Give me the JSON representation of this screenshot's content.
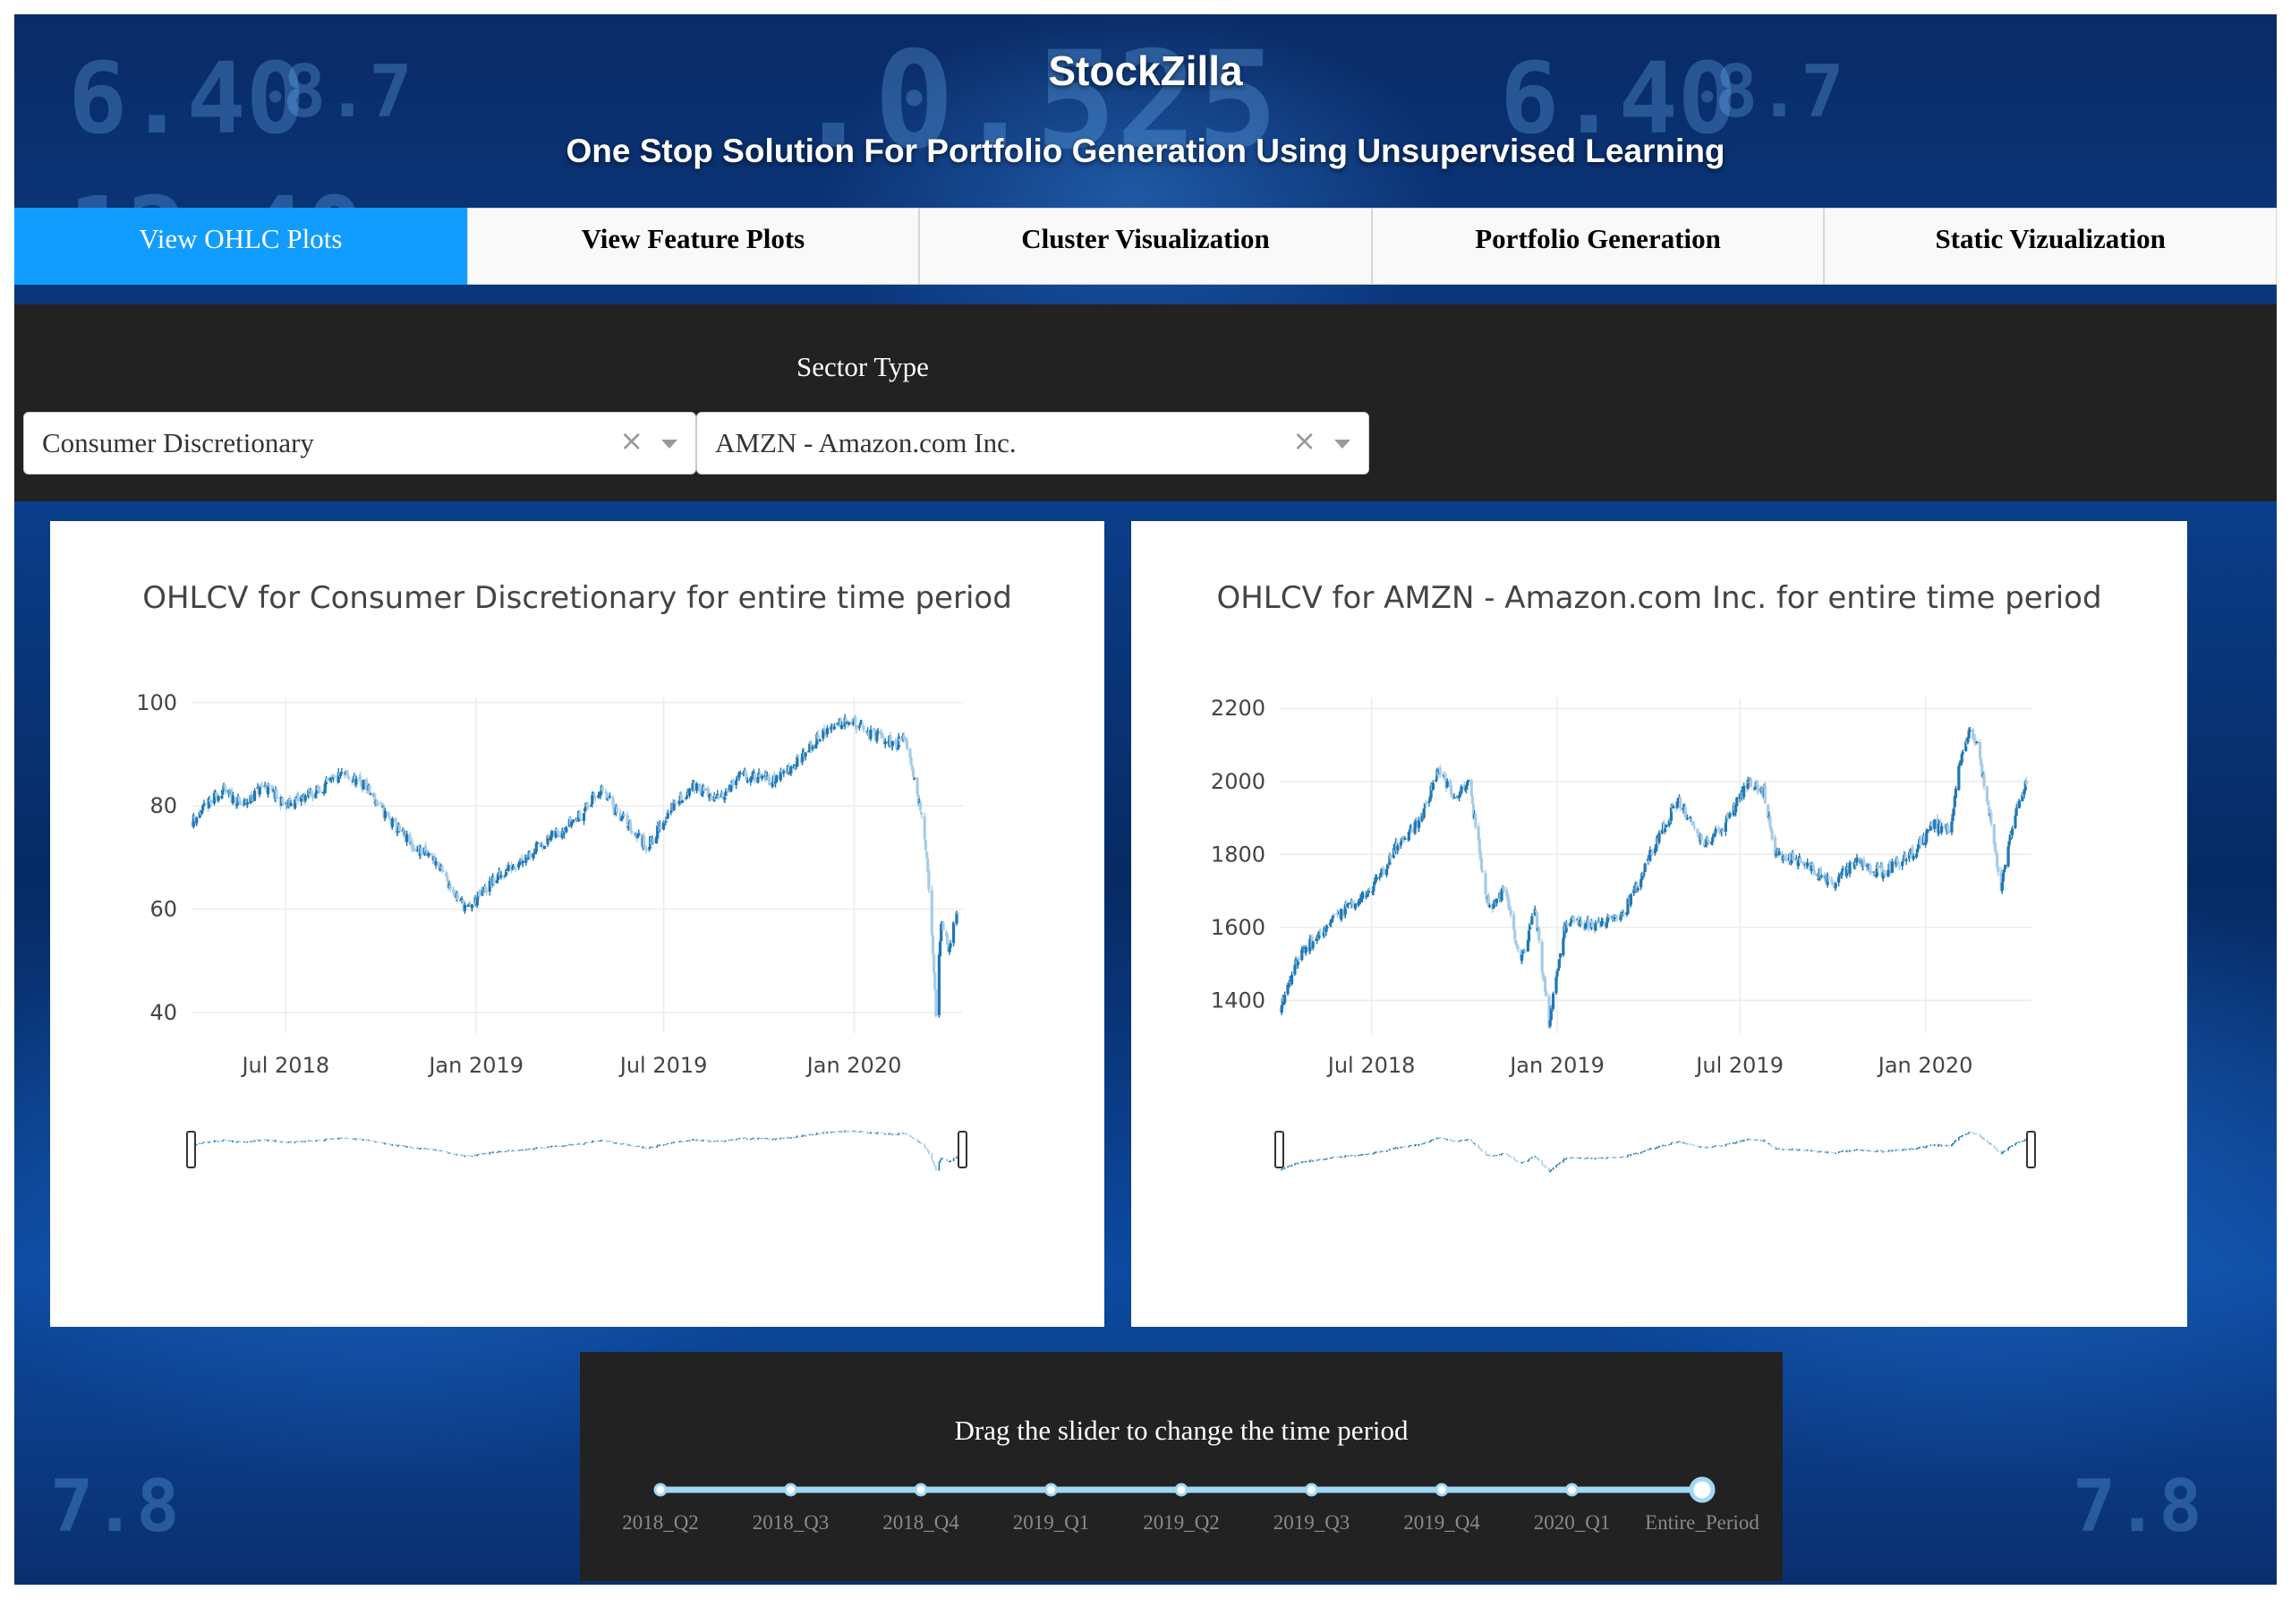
{
  "header": {
    "title": "StockZilla",
    "subtitle": "One Stop Solution For Portfolio Generation Using Unsupervised Learning"
  },
  "tabs": [
    {
      "label": "View OHLC Plots",
      "active": true
    },
    {
      "label": "View Feature Plots",
      "active": false
    },
    {
      "label": "Cluster Visualization",
      "active": false
    },
    {
      "label": "Portfolio Generation",
      "active": false
    },
    {
      "label": "Static Vizualization",
      "active": false
    }
  ],
  "controls": {
    "sector_label": "Sector Type",
    "sector_dropdown": {
      "value": "Consumer Discretionary",
      "clear_icon": "close-icon",
      "arrow_icon": "chevron-down-icon"
    },
    "stock_dropdown": {
      "value": "AMZN - Amazon.com Inc.",
      "clear_icon": "close-icon",
      "arrow_icon": "chevron-down-icon"
    }
  },
  "colors": {
    "active_tab": "#119dff",
    "panel": "#222222",
    "increasing": "#1f77b4",
    "decreasing": "#a6cce8"
  },
  "chart_data": [
    {
      "type": "candlestick",
      "title": "OHLCV for Consumer Discretionary for entire time period",
      "x_ticks": [
        "Jul 2018",
        "Jan 2019",
        "Jul 2019",
        "Jan 2020"
      ],
      "y_ticks": [
        40,
        60,
        80,
        100
      ],
      "ylim": [
        36,
        101
      ],
      "x_range": [
        "2018-04-01",
        "2020-04-15"
      ],
      "range_slider": true,
      "close_anchors": [
        {
          "date": "2018-04-01",
          "close": 77
        },
        {
          "date": "2018-05-01",
          "close": 83
        },
        {
          "date": "2018-05-20",
          "close": 80
        },
        {
          "date": "2018-06-10",
          "close": 84
        },
        {
          "date": "2018-07-01",
          "close": 80
        },
        {
          "date": "2018-08-01",
          "close": 83
        },
        {
          "date": "2018-08-25",
          "close": 86
        },
        {
          "date": "2018-09-15",
          "close": 84
        },
        {
          "date": "2018-10-10",
          "close": 77
        },
        {
          "date": "2018-11-01",
          "close": 72
        },
        {
          "date": "2018-11-20",
          "close": 70
        },
        {
          "date": "2018-12-15",
          "close": 62
        },
        {
          "date": "2018-12-24",
          "close": 60
        },
        {
          "date": "2019-01-15",
          "close": 65
        },
        {
          "date": "2019-02-15",
          "close": 70
        },
        {
          "date": "2019-03-15",
          "close": 74
        },
        {
          "date": "2019-04-10",
          "close": 78
        },
        {
          "date": "2019-05-01",
          "close": 83
        },
        {
          "date": "2019-05-25",
          "close": 77
        },
        {
          "date": "2019-06-15",
          "close": 72
        },
        {
          "date": "2019-07-10",
          "close": 80
        },
        {
          "date": "2019-08-01",
          "close": 84
        },
        {
          "date": "2019-08-20",
          "close": 81
        },
        {
          "date": "2019-09-15",
          "close": 86
        },
        {
          "date": "2019-10-15",
          "close": 85
        },
        {
          "date": "2019-11-10",
          "close": 89
        },
        {
          "date": "2019-12-01",
          "close": 94
        },
        {
          "date": "2019-12-25",
          "close": 97
        },
        {
          "date": "2020-01-15",
          "close": 94
        },
        {
          "date": "2020-02-10",
          "close": 92
        },
        {
          "date": "2020-02-20",
          "close": 93
        },
        {
          "date": "2020-03-01",
          "close": 84
        },
        {
          "date": "2020-03-10",
          "close": 72
        },
        {
          "date": "2020-03-16",
          "close": 55
        },
        {
          "date": "2020-03-20",
          "close": 40
        },
        {
          "date": "2020-03-25",
          "close": 58
        },
        {
          "date": "2020-04-01",
          "close": 52
        },
        {
          "date": "2020-04-10",
          "close": 60
        }
      ]
    },
    {
      "type": "candlestick",
      "title": "OHLCV for AMZN - Amazon.com Inc. for entire time period",
      "x_ticks": [
        "Jul 2018",
        "Jan 2019",
        "Jul 2019",
        "Jan 2020"
      ],
      "y_ticks": [
        1400,
        1600,
        1800,
        2000,
        2200
      ],
      "ylim": [
        1310,
        2230
      ],
      "x_range": [
        "2018-04-01",
        "2020-04-15"
      ],
      "range_slider": true,
      "close_anchors": [
        {
          "date": "2018-04-01",
          "close": 1380
        },
        {
          "date": "2018-04-20",
          "close": 1520
        },
        {
          "date": "2018-05-10",
          "close": 1580
        },
        {
          "date": "2018-06-01",
          "close": 1640
        },
        {
          "date": "2018-07-01",
          "close": 1700
        },
        {
          "date": "2018-07-25",
          "close": 1820
        },
        {
          "date": "2018-08-20",
          "close": 1900
        },
        {
          "date": "2018-09-05",
          "close": 2030
        },
        {
          "date": "2018-09-20",
          "close": 1960
        },
        {
          "date": "2018-10-05",
          "close": 2000
        },
        {
          "date": "2018-10-25",
          "close": 1650
        },
        {
          "date": "2018-11-10",
          "close": 1700
        },
        {
          "date": "2018-11-25",
          "close": 1500
        },
        {
          "date": "2018-12-10",
          "close": 1650
        },
        {
          "date": "2018-12-24",
          "close": 1340
        },
        {
          "date": "2019-01-10",
          "close": 1620
        },
        {
          "date": "2019-02-10",
          "close": 1600
        },
        {
          "date": "2019-03-10",
          "close": 1650
        },
        {
          "date": "2019-04-10",
          "close": 1840
        },
        {
          "date": "2019-05-01",
          "close": 1950
        },
        {
          "date": "2019-05-25",
          "close": 1830
        },
        {
          "date": "2019-06-10",
          "close": 1860
        },
        {
          "date": "2019-07-10",
          "close": 2000
        },
        {
          "date": "2019-07-25",
          "close": 1970
        },
        {
          "date": "2019-08-05",
          "close": 1800
        },
        {
          "date": "2019-09-01",
          "close": 1780
        },
        {
          "date": "2019-10-01",
          "close": 1720
        },
        {
          "date": "2019-10-25",
          "close": 1780
        },
        {
          "date": "2019-11-20",
          "close": 1750
        },
        {
          "date": "2019-12-15",
          "close": 1790
        },
        {
          "date": "2020-01-10",
          "close": 1880
        },
        {
          "date": "2020-01-25",
          "close": 1860
        },
        {
          "date": "2020-02-03",
          "close": 2040
        },
        {
          "date": "2020-02-15",
          "close": 2150
        },
        {
          "date": "2020-02-22",
          "close": 2090
        },
        {
          "date": "2020-03-05",
          "close": 1900
        },
        {
          "date": "2020-03-16",
          "close": 1700
        },
        {
          "date": "2020-03-22",
          "close": 1800
        },
        {
          "date": "2020-04-01",
          "close": 1930
        },
        {
          "date": "2020-04-10",
          "close": 2000
        }
      ]
    }
  ],
  "slider": {
    "label": "Drag the slider to change the time period",
    "marks": [
      "2018_Q2",
      "2018_Q3",
      "2018_Q4",
      "2019_Q1",
      "2019_Q2",
      "2019_Q3",
      "2019_Q4",
      "2020_Q1",
      "Entire_Period"
    ],
    "selected": "Entire_Period"
  }
}
